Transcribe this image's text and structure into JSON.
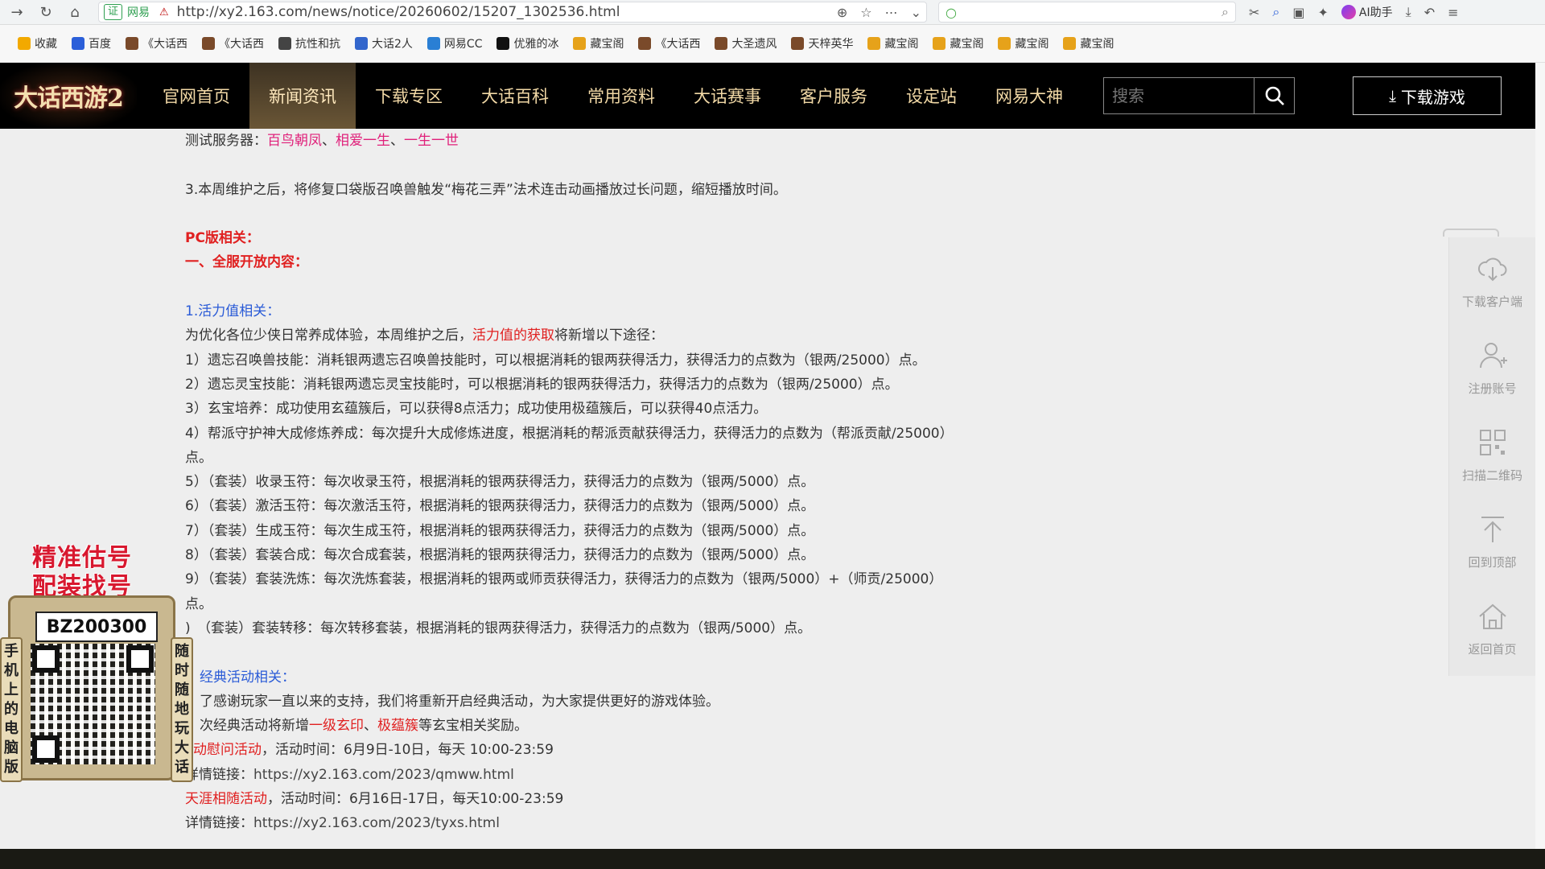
{
  "browser": {
    "cert_label": "证",
    "site_name": "网易",
    "url": "http://xy2.163.com/news/notice/20260602/15207_1302536.html",
    "ai_label": "AI助手"
  },
  "bookmarks": [
    {
      "label": "收藏",
      "color": "#f2a900"
    },
    {
      "label": "百度",
      "color": "#2b5fd9"
    },
    {
      "label": "《大话西",
      "color": "#7a4a2a"
    },
    {
      "label": "《大话西",
      "color": "#7a4a2a"
    },
    {
      "label": "抗性和抗",
      "color": "#444444"
    },
    {
      "label": "大话2人",
      "color": "#3366cc"
    },
    {
      "label": "网易CC",
      "color": "#2a7fd4"
    },
    {
      "label": "优雅的冰",
      "color": "#111111"
    },
    {
      "label": "藏宝阁",
      "color": "#e6a21a"
    },
    {
      "label": "《大话西",
      "color": "#7a4a2a"
    },
    {
      "label": "大圣遗风",
      "color": "#7a4a2a"
    },
    {
      "label": "天梓英华",
      "color": "#7a4a2a"
    },
    {
      "label": "藏宝阁",
      "color": "#e6a21a"
    },
    {
      "label": "藏宝阁",
      "color": "#e6a21a"
    },
    {
      "label": "藏宝阁",
      "color": "#e6a21a"
    },
    {
      "label": "藏宝阁",
      "color": "#e6a21a"
    }
  ],
  "site": {
    "logo_text": "大话西游2",
    "nav": [
      {
        "label": "官网首页",
        "active": false
      },
      {
        "label": "新闻资讯",
        "active": true
      },
      {
        "label": "下载专区",
        "active": false
      },
      {
        "label": "大话百科",
        "active": false
      },
      {
        "label": "常用资料",
        "active": false
      },
      {
        "label": "大话赛事",
        "active": false
      },
      {
        "label": "客户服务",
        "active": false
      },
      {
        "label": "设定站",
        "active": false
      },
      {
        "label": "网易大神",
        "active": false
      }
    ],
    "search_placeholder": "搜索",
    "download_label": "下载游戏"
  },
  "content": {
    "test_servers_label": "测试服务器：",
    "test_servers": [
      "百鸟朝凤",
      "相爱一生",
      "一生一世"
    ],
    "item3": "3.本周维护之后，将修复口袋版召唤兽触发“梅花三弄”法术连击动画播放过长问题，缩短播放时间。",
    "pc_title": "PC版相关：",
    "section1_title": "一、全服开放内容：",
    "vitality_title": "1.活力值相关：",
    "vitality_intro_a": "为优化各位少侠日常养成体验，本周维护之后，",
    "vitality_intro_link": "活力值的获取",
    "vitality_intro_b": "将新增以下途径：",
    "lines": [
      "1）遗忘召唤兽技能：消耗银两遗忘召唤兽技能时，可以根据消耗的银两获得活力，获得活力的点数为（银两/25000）点。",
      "2）遗忘灵宝技能：消耗银两遗忘灵宝技能时，可以根据消耗的银两获得活力，获得活力的点数为（银两/25000）点。",
      "3）玄宝培养：成功使用玄蕴簇后，可以获得8点活力；成功使用极蕴簇后，可以获得40点活力。",
      "4）帮派守护神大成修炼养成：每次提升大成修炼进度，根据消耗的帮派贡献获得活力，获得活力的点数为（帮派贡献/25000）",
      "点。",
      "5）（套装）收录玉符：每次收录玉符，根据消耗的银两获得活力，获得活力的点数为（银两/5000）点。",
      "6）（套装）激活玉符：每次激活玉符，根据消耗的银两获得活力，获得活力的点数为（银两/5000）点。",
      "7）（套装）生成玉符：每次生成玉符，根据消耗的银两获得活力，获得活力的点数为（银两/5000）点。",
      "8）（套装）套装合成：每次合成套装，根据消耗的银两获得活力，获得活力的点数为（银两/5000）点。",
      "9）（套装）套装洗炼：每次洗炼套装，根据消耗的银两或师贡获得活力，获得活力的点数为（银两/5000）+（师贡/25000）",
      "点。",
      ")　（套装）套装转移：每次转移套装，根据消耗的银两获得活力，获得活力的点数为（银两/5000）点。"
    ],
    "classic_title": "经典活动相关：",
    "classic_line1": "了感谢玩家一直以来的支持，我们将重新开启经典活动，为大家提供更好的游戏体验。",
    "classic_line2_a": "次经典活动将新增",
    "classic_line2_link1": "一级玄印",
    "classic_line2_sep": "、",
    "classic_line2_link2": "极蕴簇",
    "classic_line2_b": "等玄宝相关奖励。",
    "event1_name": "动慰问活动",
    "event1_time": "，活动时间：6月9日-10日，每天 10:00-23:59",
    "event1_link_label": "详情链接：",
    "event1_link": "https://xy2.163.com/2023/qmww.html",
    "event2_name": "天涯相随活动",
    "event2_time": "，活动时间：6月16日-17日，每天10:00-23:59",
    "event2_link_label": "详情链接：",
    "event2_link": "https://xy2.163.com/2023/tyxs.html"
  },
  "sidebar": {
    "items": [
      {
        "label": "下载客户端",
        "icon": "cloud-download-icon"
      },
      {
        "label": "注册账号",
        "icon": "add-user-icon"
      },
      {
        "label": "扫描二维码",
        "icon": "qr-icon"
      },
      {
        "label": "回到顶部",
        "icon": "arrow-up-icon"
      },
      {
        "label": "返回首页",
        "icon": "home-icon"
      }
    ]
  },
  "ad": {
    "title_line1": "精准估号",
    "title_line2": "配装找号",
    "code": "BZ200300",
    "left_text": "手机上的电脑版",
    "right_text": "随时随地玩大话"
  }
}
